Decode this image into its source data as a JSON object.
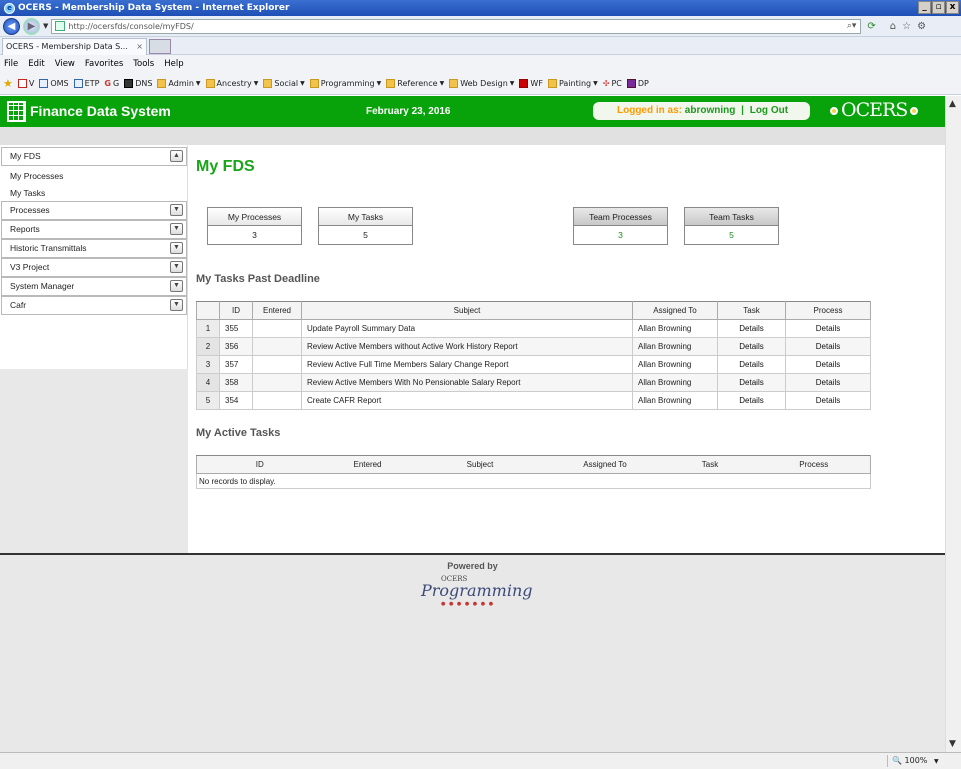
{
  "browser": {
    "title": "OCERS - Membership Data System - Internet Explorer",
    "url": "http://ocersfds/console/myFDS/",
    "tab_label": "OCERS - Membership Data S...",
    "tab_close": "×",
    "menu": [
      "File",
      "Edit",
      "View",
      "Favorites",
      "Tools",
      "Help"
    ],
    "favorites": [
      {
        "label": "V"
      },
      {
        "label": "OMS"
      },
      {
        "label": "ETP"
      },
      {
        "label": "G"
      },
      {
        "label": "DNS"
      },
      {
        "label": "Admin",
        "dropdown": true
      },
      {
        "label": "Ancestry",
        "dropdown": true
      },
      {
        "label": "Social",
        "dropdown": true
      },
      {
        "label": "Programming",
        "dropdown": true
      },
      {
        "label": "Reference",
        "dropdown": true
      },
      {
        "label": "Web Design",
        "dropdown": true
      },
      {
        "label": "WF"
      },
      {
        "label": "Painting",
        "dropdown": true
      },
      {
        "label": "PC"
      },
      {
        "label": "DP"
      }
    ],
    "zoom": "100%"
  },
  "header": {
    "app_name": "Finance Data System",
    "date": "February 23, 2016",
    "logged_in_label": "Logged in as:",
    "username": "abrowning",
    "separator": "|",
    "logout": "Log Out",
    "logo_text": "OCERS"
  },
  "sidebar": {
    "sections": [
      {
        "label": "My FDS",
        "expanded": true,
        "items": [
          "My Processes",
          "My Tasks"
        ]
      },
      {
        "label": "Processes"
      },
      {
        "label": "Reports"
      },
      {
        "label": "Historic Transmittals"
      },
      {
        "label": "V3 Project"
      },
      {
        "label": "System Manager"
      },
      {
        "label": "Cafr"
      }
    ]
  },
  "main": {
    "title": "My FDS",
    "summary": {
      "my_processes": {
        "label": "My Processes",
        "value": "3"
      },
      "my_tasks": {
        "label": "My Tasks",
        "value": "5"
      },
      "team_processes": {
        "label": "Team Processes",
        "value": "3"
      },
      "team_tasks": {
        "label": "Team Tasks",
        "value": "5"
      }
    },
    "past_deadline": {
      "title": "My Tasks Past Deadline",
      "columns": [
        "ID",
        "Entered",
        "Subject",
        "Assigned To",
        "Task",
        "Process"
      ],
      "rows": [
        {
          "n": "1",
          "id": "355",
          "entered": "",
          "subject": "Update Payroll Summary Data",
          "assigned": "Allan Browning",
          "task": "Details",
          "process": "Details"
        },
        {
          "n": "2",
          "id": "356",
          "entered": "",
          "subject": "Review Active Members without Active Work History Report",
          "assigned": "Allan Browning",
          "task": "Details",
          "process": "Details"
        },
        {
          "n": "3",
          "id": "357",
          "entered": "",
          "subject": "Review Active Full Time Members Salary Change Report",
          "assigned": "Allan Browning",
          "task": "Details",
          "process": "Details"
        },
        {
          "n": "4",
          "id": "358",
          "entered": "",
          "subject": "Review Active Members With No Pensionable Salary Report",
          "assigned": "Allan Browning",
          "task": "Details",
          "process": "Details"
        },
        {
          "n": "5",
          "id": "354",
          "entered": "",
          "subject": "Create CAFR Report",
          "assigned": "Allan Browning",
          "task": "Details",
          "process": "Details"
        }
      ]
    },
    "active_tasks": {
      "title": "My Active Tasks",
      "columns": [
        "ID",
        "Entered",
        "Subject",
        "Assigned To",
        "Task",
        "Process"
      ],
      "empty": "No records to display."
    }
  },
  "footer": {
    "powered_by": "Powered by",
    "logo_small": "OCERS",
    "logo_main": "Programming"
  },
  "colors": {
    "brand_green": "#08a30a",
    "login_orange": "#ff9900"
  }
}
